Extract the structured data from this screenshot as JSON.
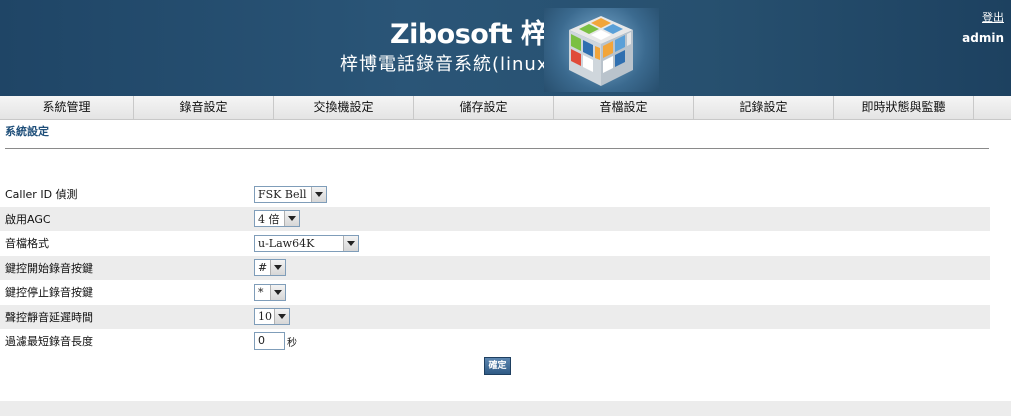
{
  "header": {
    "brand": "Zibosoft 梓博",
    "brand_mark": "®",
    "system_title": "梓博電話錄音系統(linux)",
    "logout_label": "登出",
    "username": "admin"
  },
  "nav": {
    "items": [
      {
        "label": "系統管理"
      },
      {
        "label": "錄音設定"
      },
      {
        "label": "交換機設定"
      },
      {
        "label": "儲存設定"
      },
      {
        "label": "音檔設定"
      },
      {
        "label": "記錄設定"
      },
      {
        "label": "即時狀態與監聽"
      }
    ]
  },
  "page": {
    "section_title": "系統設定",
    "apply_label": "確定"
  },
  "form": {
    "rows": [
      {
        "label": "Caller ID 偵測",
        "value": "FSK Bell"
      },
      {
        "label": "啟用AGC",
        "value": "4 倍"
      },
      {
        "label": "音檔格式",
        "value": "u-Law64K"
      },
      {
        "label": "鍵控開始錄音按鍵",
        "value": "#"
      },
      {
        "label": "鍵控停止錄音按鍵",
        "value": "*"
      },
      {
        "label": "聲控靜音延遲時間",
        "value": "10"
      },
      {
        "label": "過濾最短錄音長度",
        "value": "0",
        "unit": "秒"
      }
    ]
  }
}
